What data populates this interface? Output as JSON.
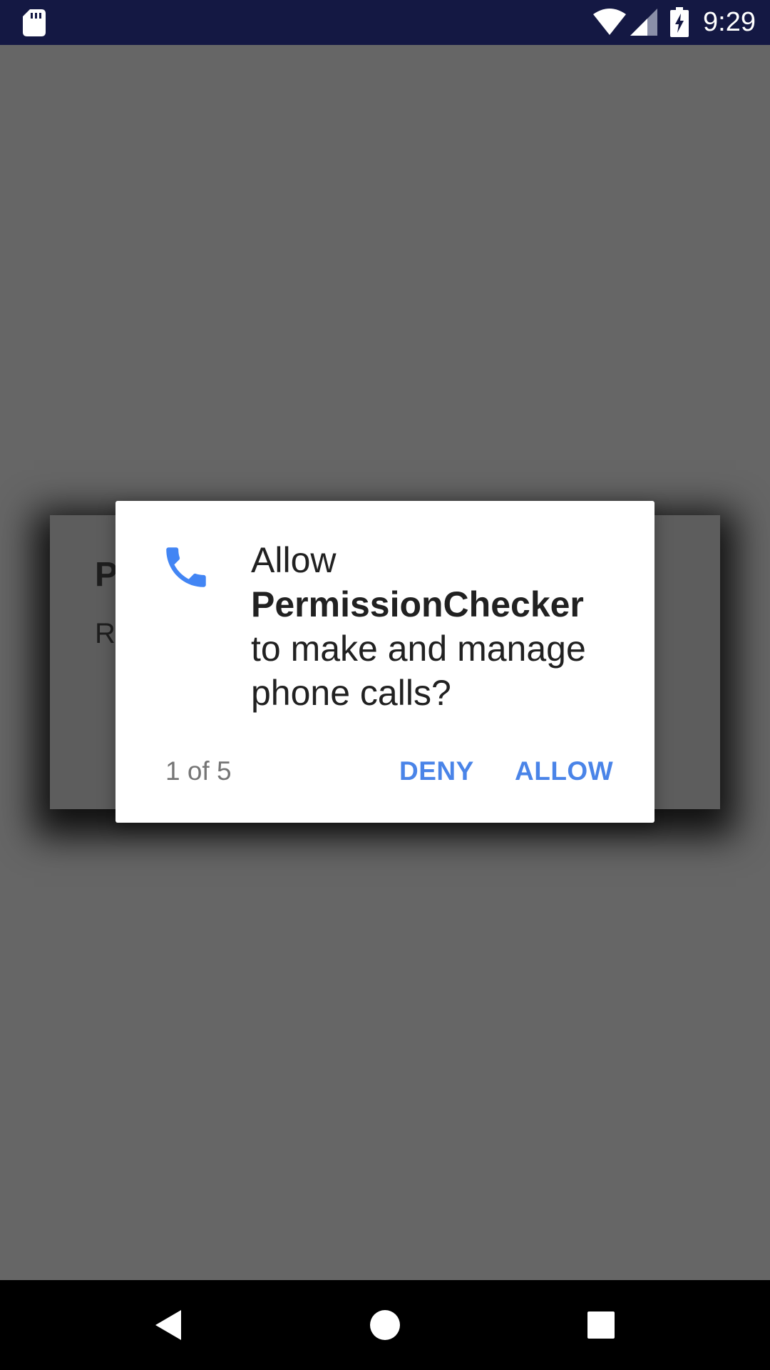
{
  "status_bar": {
    "time": "9:29",
    "icons": [
      "sd-card-icon",
      "wifi-icon",
      "signal-icon",
      "battery-charging-icon"
    ]
  },
  "app": {
    "card_title": "P",
    "card_text": "R",
    "card_action": "!"
  },
  "dialog": {
    "icon": "phone-icon",
    "message_prefix": "Allow",
    "app_name": "PermissionChecker",
    "message_line1": "to make and manage",
    "message_line2": "phone calls?",
    "counter": "1 of 5",
    "deny_label": "DENY",
    "allow_label": "ALLOW",
    "accent_color": "#4a84e8"
  },
  "nav_bar": {
    "icons": [
      "back-icon",
      "home-icon",
      "recents-icon"
    ]
  },
  "colors": {
    "status_bar_bg": "#141843",
    "scrim": "#666666",
    "dialog_bg": "#ffffff"
  }
}
